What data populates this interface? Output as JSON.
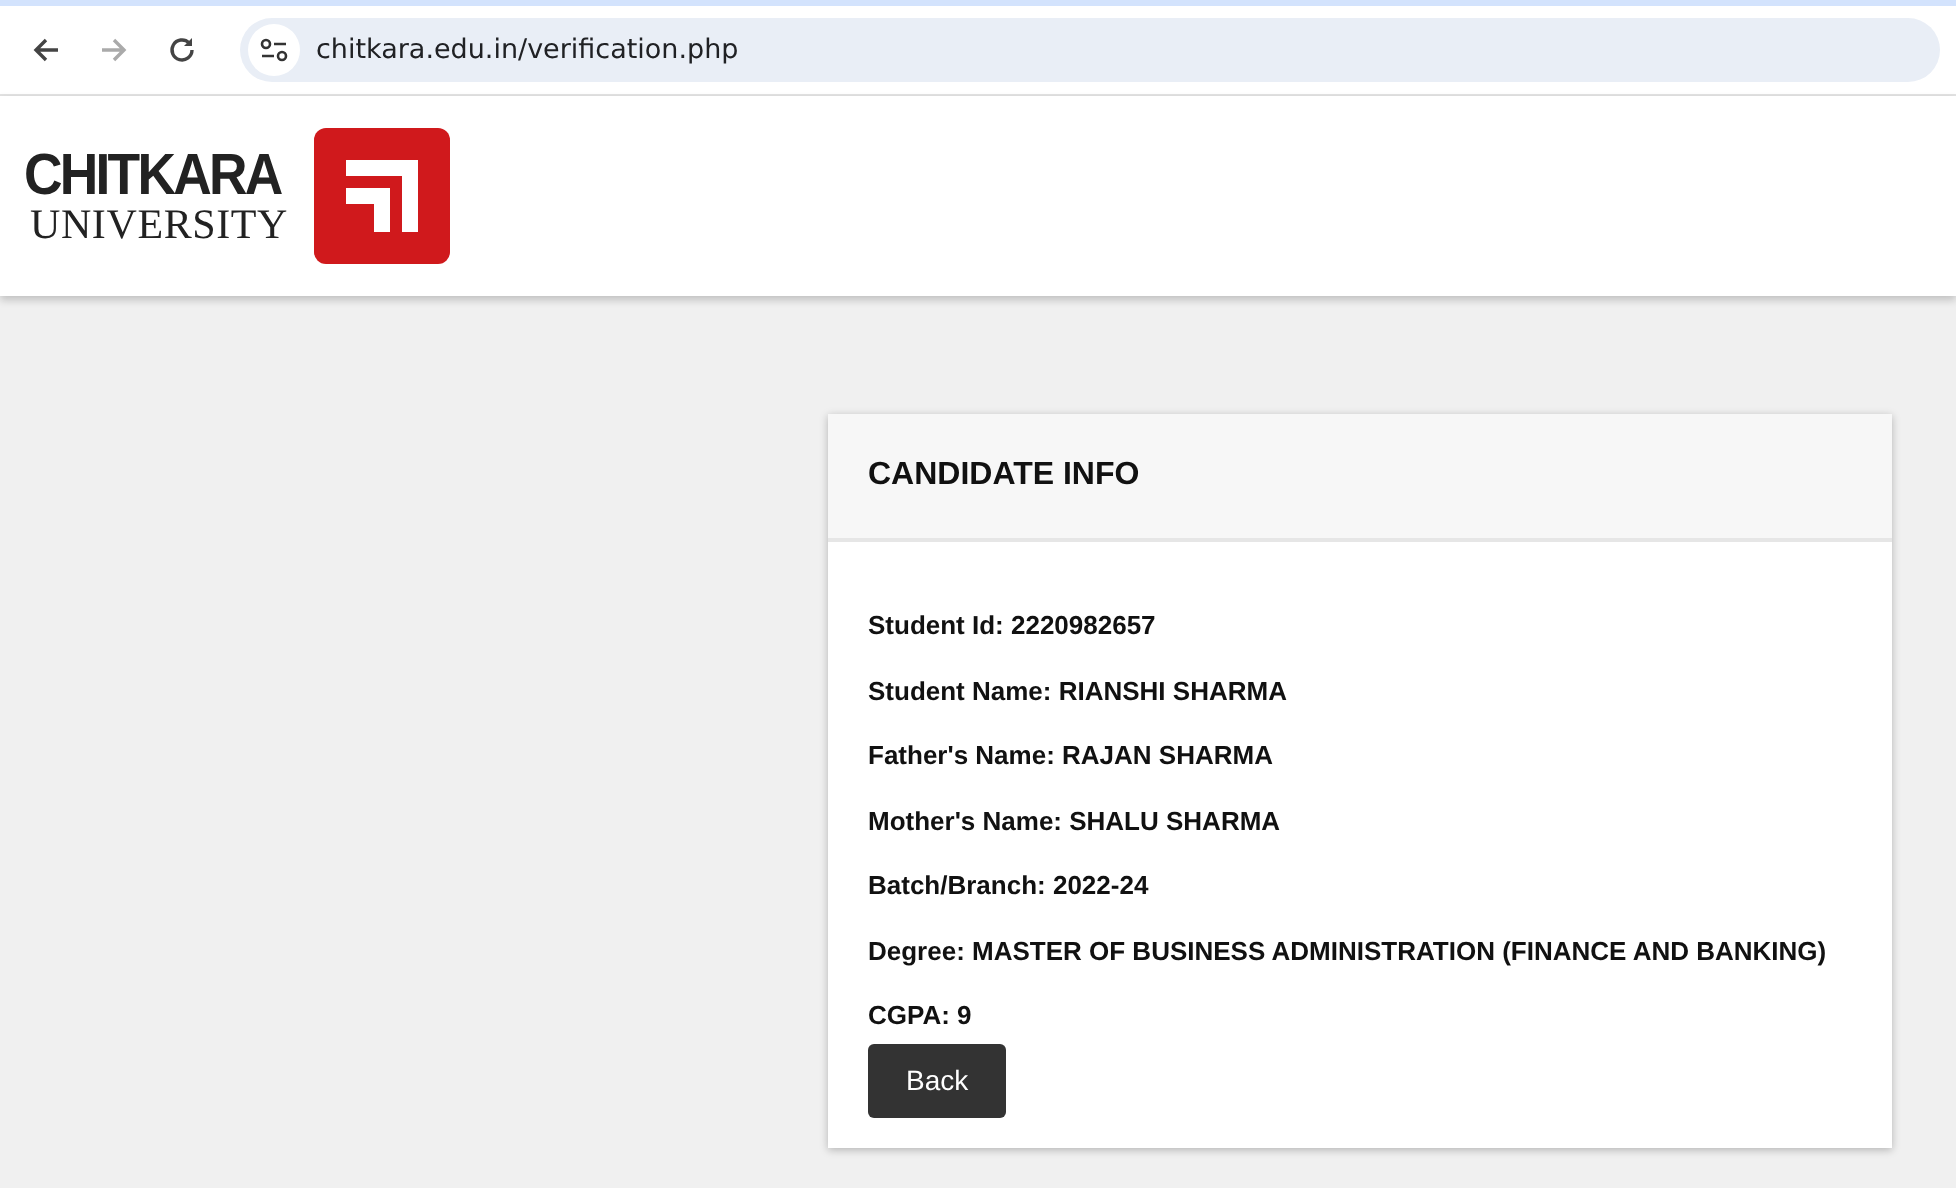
{
  "browser": {
    "url": "chitkara.edu.in/verification.php"
  },
  "logo": {
    "line_1": "CHITKARA",
    "line_2": "UNIVERSITY"
  },
  "card": {
    "title": "CANDIDATE INFO",
    "fields": [
      "Student Id: 2220982657",
      "Student Name: RIANSHI SHARMA",
      "Father's Name: RAJAN SHARMA",
      "Mother's Name: SHALU SHARMA",
      "Batch/Branch: 2022-24",
      "Degree: MASTER OF BUSINESS ADMINISTRATION (FINANCE AND BANKING)",
      "CGPA: 9"
    ],
    "button": "Back"
  }
}
